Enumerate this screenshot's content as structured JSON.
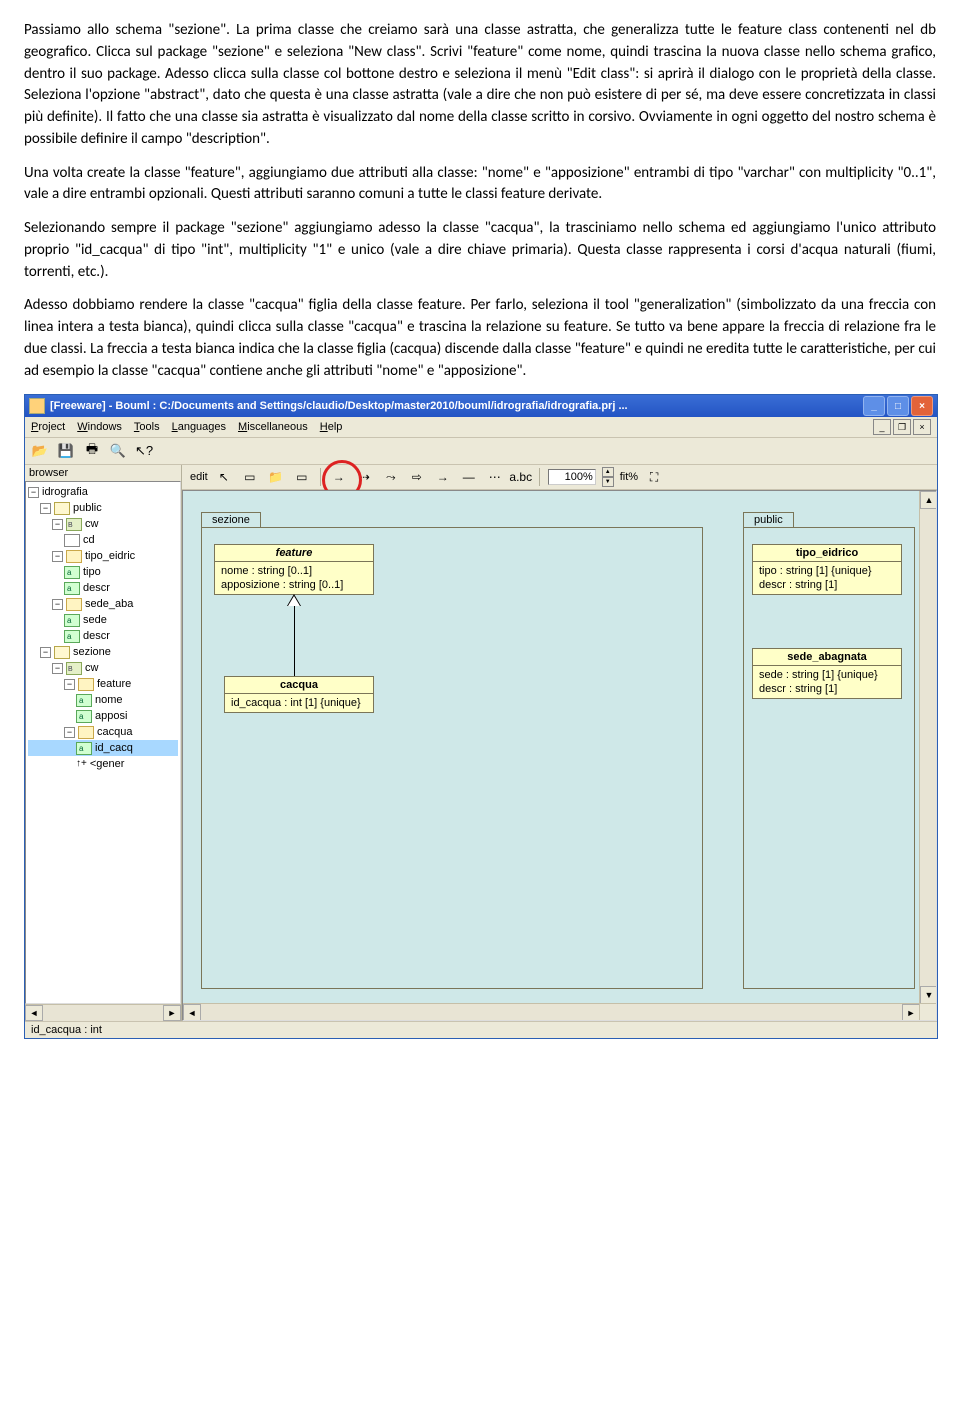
{
  "doc": {
    "p1": "Passiamo allo schema \"sezione\". La prima classe che creiamo sarà una classe astratta, che generalizza tutte le feature class contenenti nel db geografico. Clicca sul package \"sezione\" e seleziona \"New class\". Scrivi \"feature\" come nome, quindi trascina la nuova classe nello schema grafico, dentro il suo package. Adesso clicca sulla classe col bottone destro e seleziona il menù \"Edit class\": si aprirà il dialogo con le proprietà della classe. Seleziona l'opzione \"abstract\", dato che questa è una classe astratta (vale a dire che non può esistere di per sé, ma deve essere concretizzata in classi più definite). Il fatto che una classe sia astratta è visualizzato dal nome della classe scritto in corsivo. Ovviamente in ogni oggetto del nostro schema è possibile definire il campo \"description\".",
    "p2": "Una volta create la classe \"feature\", aggiungiamo due attributi alla classe: \"nome\" e \"apposizione\" entrambi di tipo \"varchar\" con multiplicity \"0..1\", vale a dire entrambi opzionali. Questi attributi saranno comuni a tutte le classi feature derivate.",
    "p3": "Selezionando sempre il package \"sezione\" aggiungiamo adesso la classe \"cacqua\", la trasciniamo nello schema ed aggiungiamo l'unico attributo proprio \"id_cacqua\" di tipo \"int\", multiplicity \"1\" e unico (vale a dire chiave primaria). Questa classe rappresenta i corsi d'acqua naturali (fiumi, torrenti, etc.).",
    "p4": "Adesso dobbiamo rendere la classe \"cacqua\" figlia della classe feature. Per farlo, seleziona il tool \"generalization\" (simbolizzato da una freccia con linea intera a testa bianca), quindi clicca sulla classe \"cacqua\" e trascina la relazione su feature. Se tutto va bene appare la freccia di relazione fra le due classi. La freccia a testa bianca indica che la classe figlia (cacqua) discende dalla classe \"feature\" e quindi ne eredita tutte le caratteristiche, per cui ad esempio la classe \"cacqua\" contiene anche gli attributi \"nome\" e \"apposizione\"."
  },
  "app": {
    "title": "[Freeware] - Bouml : C:/Documents and Settings/claudio/Desktop/master2010/bouml/idrografia/idrografia.prj ...",
    "menus": [
      "Project",
      "Windows",
      "Tools",
      "Languages",
      "Miscellaneous",
      "Help"
    ],
    "browser_label": "browser",
    "tree": {
      "root": "idrografia",
      "public": "public",
      "cw1": "cw",
      "cd": "cd",
      "tipo_eidric": "tipo_eidric",
      "tipo": "tipo",
      "descr": "descr",
      "sede_aba": "sede_aba",
      "sede": "sede",
      "descr2": "descr",
      "sezione": "sezione",
      "cw2": "cw",
      "feature": "feature",
      "nome": "nome",
      "apposi": "apposi",
      "cacqua": "cacqua",
      "id_cacq": "id_cacq",
      "gener": "<gener"
    },
    "edit_label": "edit",
    "zoom": "100%",
    "fit": "fit%",
    "diagram": {
      "sezione_label": "sezione",
      "public_label": "public",
      "feature": {
        "title": "feature",
        "a1": "nome : string [0..1]",
        "a2": "apposizione : string [0..1]"
      },
      "cacqua": {
        "title": "cacqua",
        "a1": "id_cacqua : int [1] {unique}"
      },
      "tipo_eidrico": {
        "title": "tipo_eidrico",
        "a1": "tipo : string [1] {unique}",
        "a2": "descr : string [1]"
      },
      "sede_abagnata": {
        "title": "sede_abagnata",
        "a1": "sede : string [1] {unique}",
        "a2": "descr : string [1]"
      }
    },
    "status": "id_cacqua : int"
  }
}
